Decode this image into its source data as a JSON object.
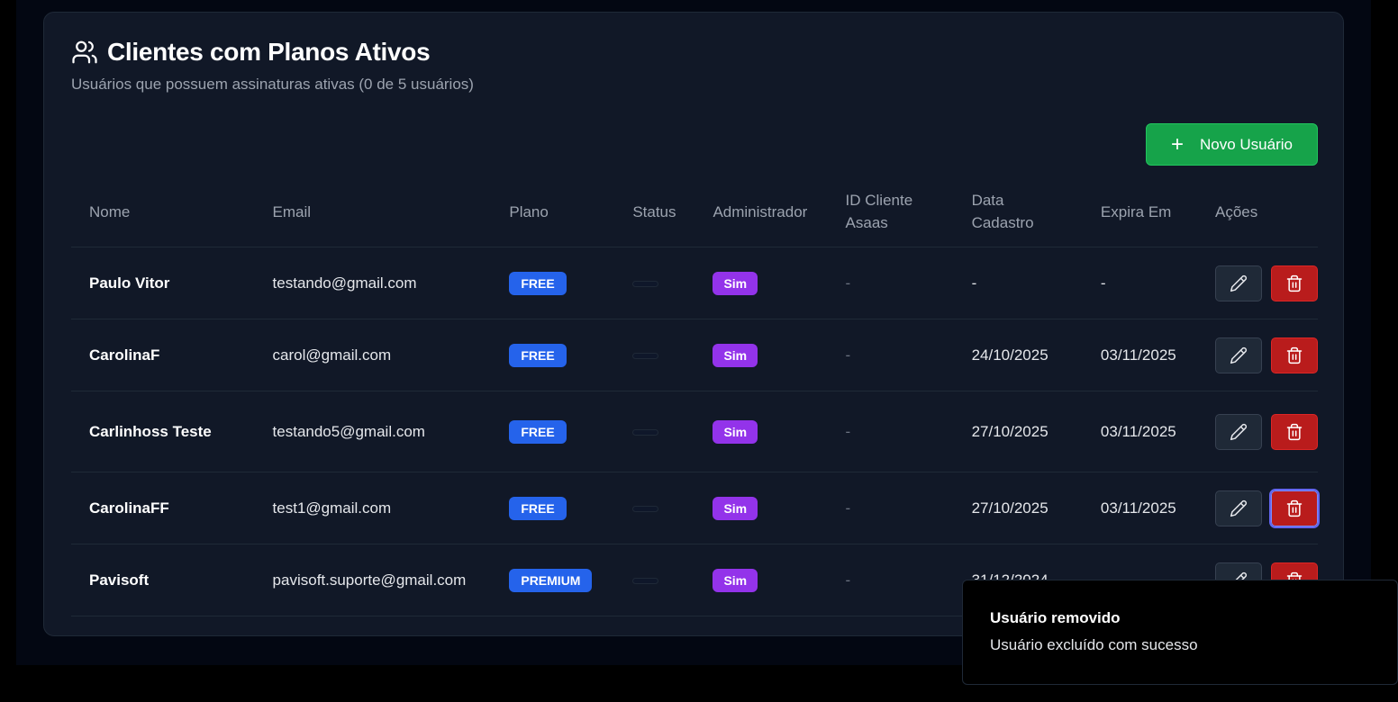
{
  "header": {
    "title": "Clientes com Planos Ativos",
    "subtitle": "Usuários que possuem assinaturas ativas (0 de 5 usuários)"
  },
  "toolbar": {
    "new_user_label": "Novo Usuário",
    "new_user_icon": "plus-icon"
  },
  "table": {
    "headers": {
      "name": "Nome",
      "email": "Email",
      "plan": "Plano",
      "status": "Status",
      "admin": "Administrador",
      "asaas_id_line1": "ID Cliente",
      "asaas_id_line2": "Asaas",
      "created_line1": "Data",
      "created_line2": "Cadastro",
      "expires": "Expira Em",
      "actions": "Ações"
    },
    "rows": [
      {
        "name": "Paulo Vitor",
        "email": "testando@gmail.com",
        "plan": "FREE",
        "admin": "Sim",
        "asaas_id": "-",
        "created": "-",
        "expires": "-"
      },
      {
        "name": "CarolinaF",
        "email": "carol@gmail.com",
        "plan": "FREE",
        "admin": "Sim",
        "asaas_id": "-",
        "created": "24/10/2025",
        "expires": "03/11/2025"
      },
      {
        "name": "Carlinhoss Teste",
        "email": "testando5@gmail.com",
        "plan": "FREE",
        "admin": "Sim",
        "asaas_id": "-",
        "created": "27/10/2025",
        "expires": "03/11/2025"
      },
      {
        "name": "CarolinaFF",
        "email": "test1@gmail.com",
        "plan": "FREE",
        "admin": "Sim",
        "asaas_id": "-",
        "created": "27/10/2025",
        "expires": "03/11/2025"
      },
      {
        "name": "Pavisoft",
        "email": "pavisoft.suporte@gmail.com",
        "plan": "PREMIUM",
        "admin": "Sim",
        "asaas_id": "-",
        "created": "31/12/2024",
        "expires": "-"
      }
    ]
  },
  "toast": {
    "title": "Usuário removido",
    "description": "Usuário excluído com sucesso"
  },
  "colors": {
    "plan_badge": "#2563eb",
    "admin_badge": "#9333ea",
    "primary_button": "#16a34a",
    "delete_button": "#b91c1c"
  }
}
